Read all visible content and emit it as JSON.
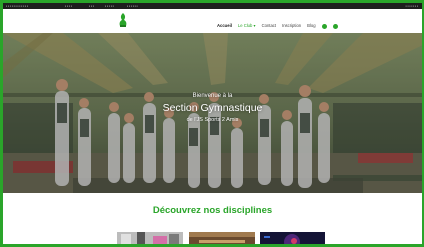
{
  "admin_bar": {
    "items": [
      "▪ ▪ ▪ ▪ ▪ ▪ ▪ ▪ ▪ ▪ ▪ ▪",
      "▪ ▪ ▪ ▪",
      "▪ ▪ ▪",
      "▪ ▪ ▪ ▪ ▪",
      "▪ ▪ ▪ ▪ ▪ ▪"
    ],
    "right": "▪ ▪ ▪ ▪ ▪ ▪ ▪"
  },
  "nav": {
    "items": [
      {
        "label": "Accueil"
      },
      {
        "label": "Le Club ▾"
      },
      {
        "label": "Contact"
      },
      {
        "label": "Inscription"
      },
      {
        "label": "Blog"
      }
    ]
  },
  "hero": {
    "pretitle": "Bienvenue à la",
    "title": "Section Gymnastique",
    "subtitle": "de l'JS Sports 2 Amis"
  },
  "disciplines": {
    "title": "Découvrez nos disciplines"
  },
  "colors": {
    "accent": "#2aa52a",
    "admin_bar": "#1e1e1e"
  }
}
